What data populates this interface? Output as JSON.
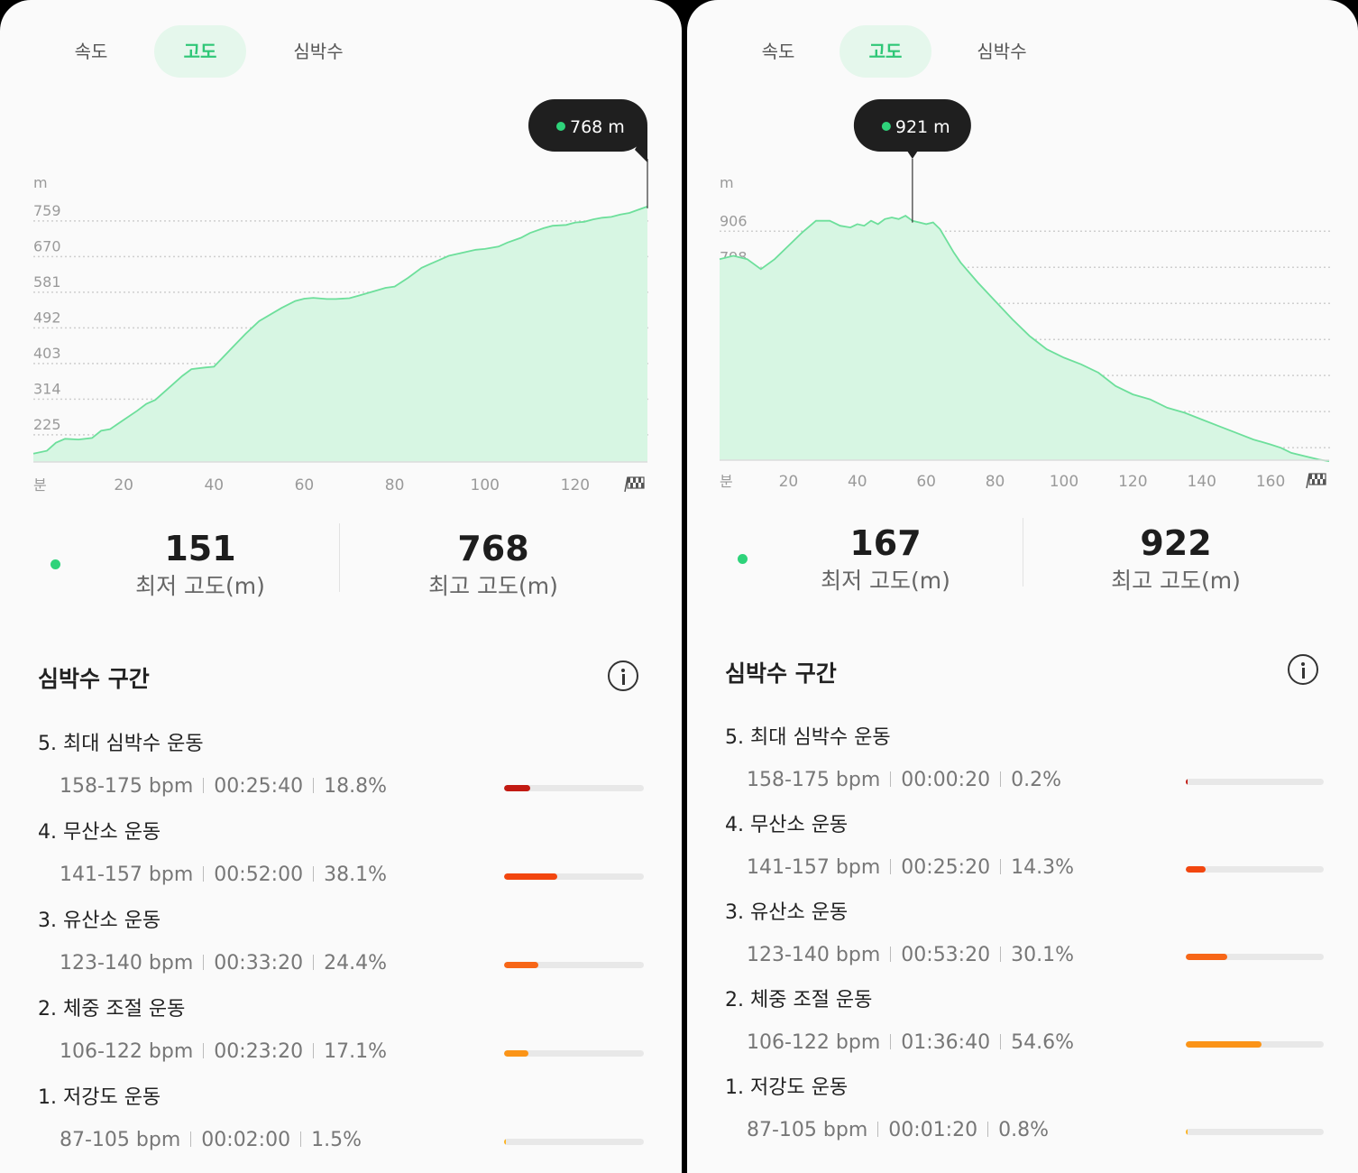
{
  "tabs": [
    "속도",
    "고도",
    "심박수"
  ],
  "active_tab": 1,
  "panels": [
    {
      "id": "left",
      "tooltip": "768 m",
      "chart_data": {
        "type": "area",
        "ylabel": "m",
        "xlabel": "분",
        "y_ticks": [
          225,
          314,
          403,
          492,
          581,
          670,
          759
        ],
        "ylim": [
          130,
          770
        ],
        "x_ticks": [
          20,
          40,
          60,
          80,
          100,
          120
        ],
        "xlim": [
          0,
          136
        ],
        "x": [
          0,
          3,
          5,
          7,
          10,
          13,
          15,
          17,
          20,
          23,
          25,
          27,
          30,
          33,
          35,
          38,
          40,
          44,
          47,
          50,
          55,
          58,
          60,
          62,
          65,
          67,
          70,
          72,
          75,
          78,
          80,
          83,
          86,
          88,
          90,
          92,
          94,
          96,
          98,
          100,
          103,
          105,
          108,
          110,
          113,
          115,
          118,
          120,
          122,
          124,
          126,
          128,
          130,
          132,
          134,
          136
        ],
        "values": [
          151,
          158,
          178,
          188,
          186,
          190,
          208,
          212,
          235,
          258,
          275,
          285,
          315,
          345,
          362,
          366,
          368,
          415,
          450,
          482,
          515,
          532,
          538,
          540,
          537,
          537,
          539,
          545,
          555,
          565,
          568,
          590,
          615,
          625,
          635,
          645,
          650,
          655,
          660,
          662,
          668,
          678,
          690,
          702,
          714,
          720,
          722,
          728,
          730,
          736,
          740,
          742,
          748,
          752,
          760,
          768
        ],
        "marker_x": 136
      },
      "stats": {
        "min_value": "151",
        "min_label": "최저 고도(m)",
        "max_value": "768",
        "max_label": "최고 고도(m)"
      },
      "zones_title": "심박수 구간",
      "zones": [
        {
          "title": "5. 최대 심박수 운동",
          "bpm": "158-175 bpm",
          "time": "00:25:40",
          "pct": "18.8%",
          "fraction": 0.188,
          "color": "#c21a12"
        },
        {
          "title": "4. 무산소 운동",
          "bpm": "141-157 bpm",
          "time": "00:52:00",
          "pct": "38.1%",
          "fraction": 0.381,
          "color": "#f2460f"
        },
        {
          "title": "3. 유산소 운동",
          "bpm": "123-140 bpm",
          "time": "00:33:20",
          "pct": "24.4%",
          "fraction": 0.244,
          "color": "#f76617"
        },
        {
          "title": "2. 체중 조절 운동",
          "bpm": "106-122 bpm",
          "time": "00:23:20",
          "pct": "17.1%",
          "fraction": 0.171,
          "color": "#fb9417"
        },
        {
          "title": "1. 저강도 운동",
          "bpm": "87-105 bpm",
          "time": "00:02:00",
          "pct": "1.5%",
          "fraction": 0.015,
          "color": "#fcb424"
        }
      ]
    },
    {
      "id": "right",
      "tooltip": "921 m",
      "chart_data": {
        "type": "area",
        "ylabel": "m",
        "xlabel": "분",
        "y_ticks": [
          258,
          366,
          474,
          582,
          690,
          798,
          906
        ],
        "ylim": [
          188,
          950
        ],
        "x_ticks": [
          20,
          40,
          60,
          80,
          100,
          120,
          140,
          160
        ],
        "xlim": [
          0,
          177
        ],
        "x": [
          0,
          4,
          8,
          12,
          16,
          20,
          24,
          28,
          32,
          35,
          38,
          40,
          42,
          44,
          46,
          48,
          50,
          52,
          54,
          56,
          58,
          60,
          62,
          64,
          66,
          68,
          70,
          75,
          80,
          85,
          90,
          95,
          100,
          105,
          110,
          115,
          120,
          125,
          130,
          135,
          140,
          145,
          150,
          155,
          160,
          163,
          166,
          170,
          174,
          177
        ],
        "values": [
          790,
          800,
          790,
          760,
          790,
          830,
          870,
          905,
          905,
          890,
          885,
          895,
          890,
          905,
          895,
          910,
          915,
          910,
          920,
          905,
          900,
          895,
          900,
          880,
          845,
          810,
          780,
          720,
          665,
          610,
          560,
          520,
          495,
          475,
          450,
          410,
          385,
          370,
          345,
          330,
          310,
          290,
          270,
          250,
          235,
          225,
          210,
          200,
          190,
          185
        ],
        "marker_x": 56
      },
      "stats": {
        "min_value": "167",
        "min_label": "최저 고도(m)",
        "max_value": "922",
        "max_label": "최고 고도(m)"
      },
      "zones_title": "심박수 구간",
      "zones": [
        {
          "title": "5. 최대 심박수 운동",
          "bpm": "158-175 bpm",
          "time": "00:00:20",
          "pct": "0.2%",
          "fraction": 0.002,
          "color": "#c21a12"
        },
        {
          "title": "4. 무산소 운동",
          "bpm": "141-157 bpm",
          "time": "00:25:20",
          "pct": "14.3%",
          "fraction": 0.143,
          "color": "#f2460f"
        },
        {
          "title": "3. 유산소 운동",
          "bpm": "123-140 bpm",
          "time": "00:53:20",
          "pct": "30.1%",
          "fraction": 0.301,
          "color": "#f76617"
        },
        {
          "title": "2. 체중 조절 운동",
          "bpm": "106-122 bpm",
          "time": "01:36:40",
          "pct": "54.6%",
          "fraction": 0.546,
          "color": "#fb9417"
        },
        {
          "title": "1. 저강도 운동",
          "bpm": "87-105 bpm",
          "time": "00:01:20",
          "pct": "0.8%",
          "fraction": 0.008,
          "color": "#fcb424"
        }
      ]
    }
  ]
}
